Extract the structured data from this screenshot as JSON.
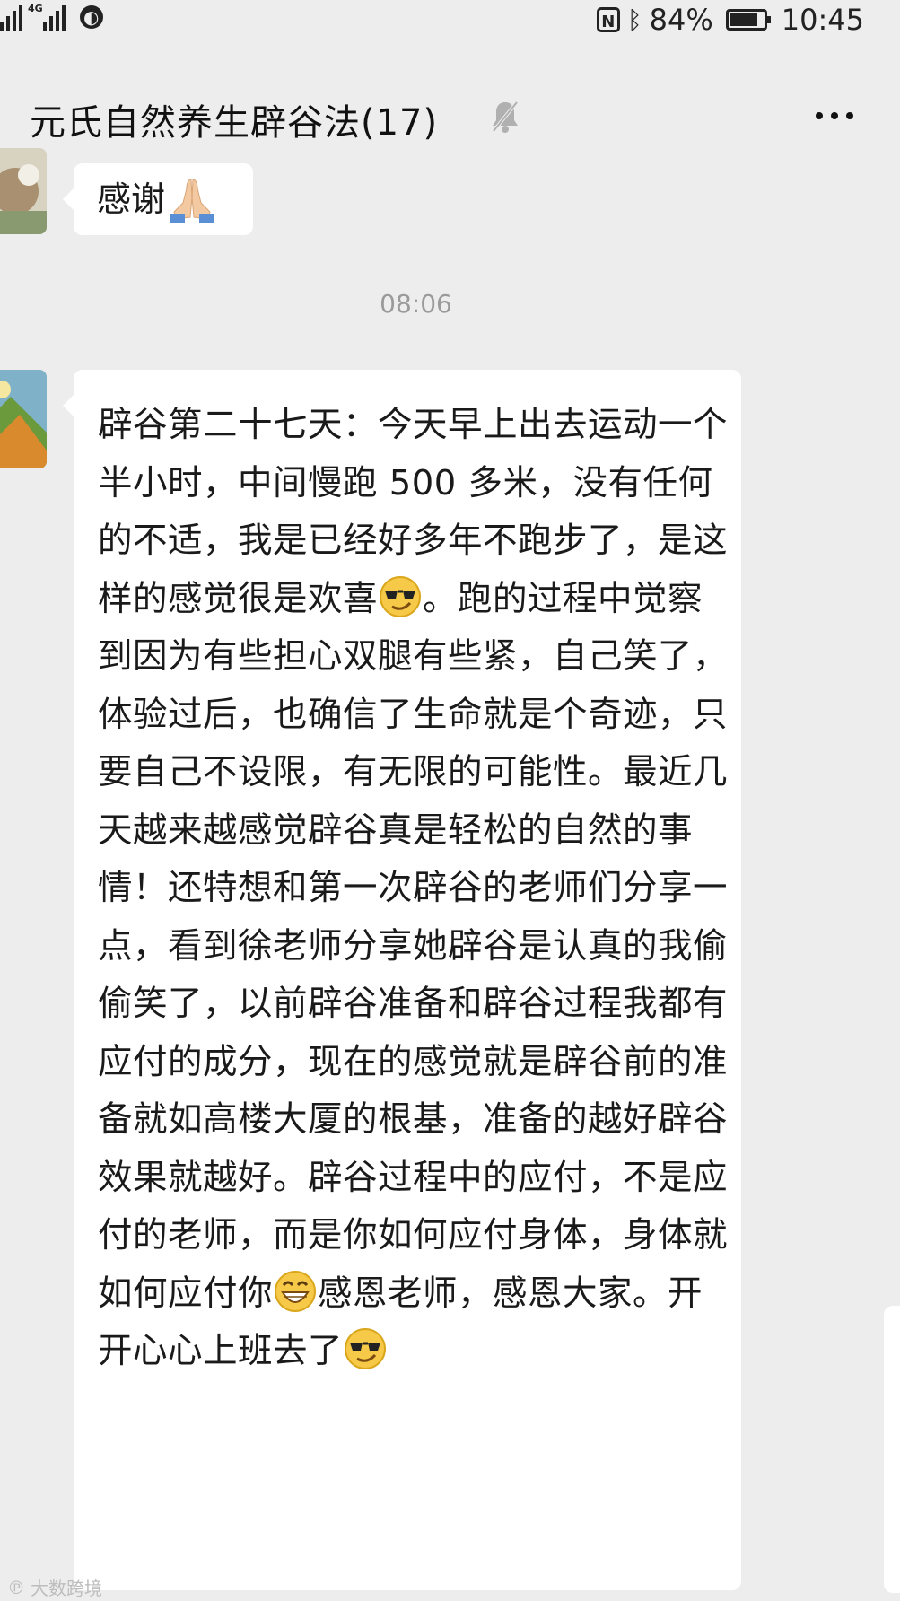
{
  "status_bar": {
    "network": "4G",
    "battery": "84%",
    "time": "10:45",
    "nfc_label": "N",
    "battery_level": 0.84
  },
  "header": {
    "title": "元氏自然养生辟谷法(17)",
    "mute_icon": "bell-mute-icon",
    "more_icon": "more-icon"
  },
  "messages": [
    {
      "type": "text",
      "text": "感谢",
      "emoji": "pray-icon"
    },
    {
      "type": "timestamp",
      "text": "08:06"
    },
    {
      "type": "text",
      "segments": [
        "辟谷第二十七天：今天早上出去运动一个半小时，中间慢跑 500 多米，没有任何的不适，我是已经好多年不跑步了，是这样的感觉很是欢喜",
        "。跑的过程中觉察到因为有些担心双腿有些紧，自己笑了，体验过后，也确信了生命就是个奇迹，只要自己不设限，有无限的可能性。最近几天越来越感觉辟谷真是轻松的自然的事情！还特想和第一次辟谷的老师们分享一点，看到徐老师分享她辟谷是认真的我偷偷笑了，以前辟谷准备和辟谷过程我都有应付的成分，现在的感觉就是辟谷前的准备就如高楼大厦的根基，准备的越好辟谷效果就越好。辟谷过程中的应付，不是应付的老师，而是你如何应付身体，身体就如何应付你",
        "感恩老师，感恩大家。开开心心上班去了"
      ],
      "emojis": [
        "sunglasses-emoji-icon",
        "grin-emoji-icon",
        "sunglasses-emoji-icon"
      ]
    }
  ],
  "watermark": "大数跨境"
}
